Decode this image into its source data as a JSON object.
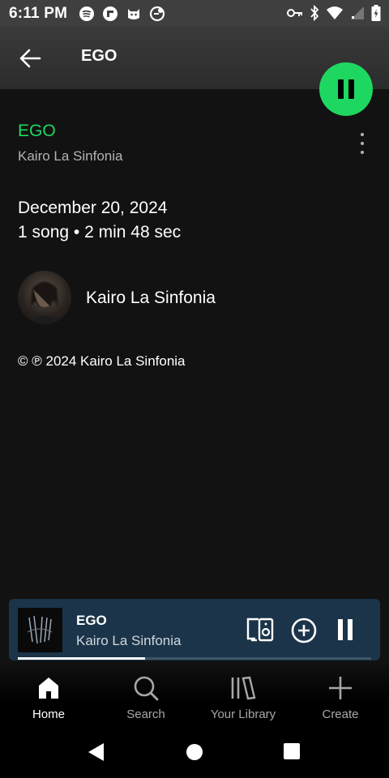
{
  "status_bar": {
    "time": "6:11 PM",
    "left_icons": [
      "spotify-icon",
      "flipboard-icon",
      "cat-app-icon",
      "vpn-globe-icon"
    ],
    "right_icons": [
      "key-icon",
      "bluetooth-icon",
      "wifi-icon",
      "signal-icon",
      "battery-charging-icon"
    ]
  },
  "header": {
    "back_icon": "arrow-left-icon",
    "title": "EGO"
  },
  "play_button": {
    "icon": "pause-icon",
    "color": "#1ed760"
  },
  "track": {
    "title": "EGO",
    "artist": "Kairo La Sinfonia",
    "title_color": "#1ed760"
  },
  "release": {
    "date": "December 20, 2024",
    "meta": "1 song • 2 min 48 sec"
  },
  "artist_row": {
    "name": "Kairo La Sinfonia"
  },
  "copyright": "© ℗ 2024 Kairo La Sinfonia",
  "mini_player": {
    "title": "EGO",
    "artist": "Kairo La Sinfonia",
    "progress": 0.36,
    "background": "#1b3449",
    "icons": [
      "connect-device-icon",
      "add-circle-icon",
      "pause-icon"
    ]
  },
  "bottom_nav": {
    "items": [
      {
        "label": "Home",
        "icon": "home-icon",
        "active": true
      },
      {
        "label": "Search",
        "icon": "search-icon",
        "active": false
      },
      {
        "label": "Your Library",
        "icon": "library-icon",
        "active": false
      },
      {
        "label": "Create",
        "icon": "plus-icon",
        "active": false
      }
    ]
  }
}
